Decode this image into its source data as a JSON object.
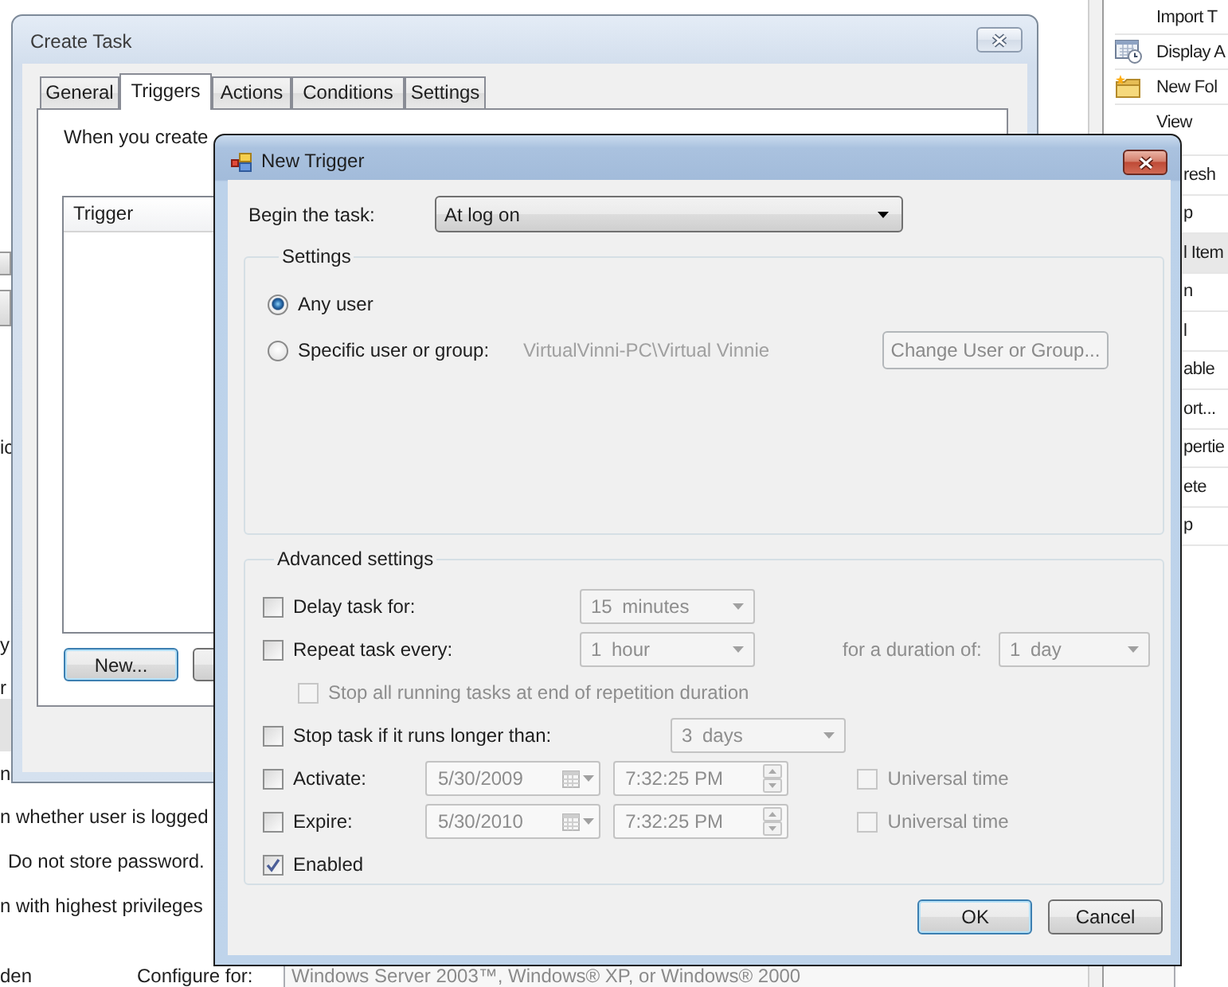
{
  "background_window": {
    "left_edge": [
      {
        "kind": "button"
      },
      {
        "kind": "button"
      },
      {
        "kind": "text",
        "text": "ic",
        "selected": false
      },
      {
        "kind": "text",
        "text": "y",
        "selected": false
      },
      {
        "kind": "text",
        "text": "r",
        "selected": false
      },
      {
        "kind": "row",
        "selected": true
      },
      {
        "kind": "text",
        "text": "n",
        "selected": false
      }
    ],
    "options": [
      "n whether user is logged",
      "Do not store password.",
      "n with highest privileges"
    ],
    "bottom_left_text": "den",
    "configure": {
      "label": "Configure for:",
      "value": "Windows Server 2003™, Windows® XP, or Windows® 2000",
      "disabled": true
    },
    "actions": [
      {
        "kind": "action",
        "label": "Import T"
      },
      {
        "kind": "action",
        "label": "Display A"
      },
      {
        "kind": "action",
        "label": "New Fol"
      },
      {
        "kind": "action",
        "label": "View"
      }
    ],
    "actions_partly_hidden": [
      {
        "kind": "action",
        "label": "resh"
      },
      {
        "kind": "action",
        "label": "p"
      },
      {
        "kind": "header",
        "label": "l Item"
      },
      {
        "kind": "action",
        "label": "n"
      },
      {
        "kind": "action",
        "label": "l"
      },
      {
        "kind": "action",
        "label": "able"
      },
      {
        "kind": "action",
        "label": "ort..."
      },
      {
        "kind": "action",
        "label": "pertie"
      },
      {
        "kind": "action",
        "label": "ete"
      },
      {
        "kind": "action",
        "label": "p"
      }
    ]
  },
  "create_task": {
    "title": "Create Task",
    "tabs": [
      {
        "label": "General",
        "selected": false
      },
      {
        "label": "Triggers",
        "selected": true
      },
      {
        "label": "Actions",
        "selected": false
      },
      {
        "label": "Conditions",
        "selected": false
      },
      {
        "label": "Settings",
        "selected": false
      }
    ],
    "description": "When you create",
    "trigger_list": {
      "columns": [
        "Trigger"
      ]
    },
    "buttons": [
      {
        "kind": "labeled",
        "label": "New...",
        "default": true
      },
      {
        "kind": "covered",
        "default": false
      }
    ]
  },
  "new_trigger": {
    "title": "New Trigger",
    "begin": {
      "label": "Begin the task:",
      "value": "At log on"
    },
    "settings": {
      "title": "Settings",
      "options": [
        {
          "label": "Any user",
          "selected": true
        },
        {
          "label": "Specific user or group:",
          "selected": false,
          "user": "VirtualVinni-PC\\Virtual Vinnie",
          "user_disabled": true,
          "button": {
            "label": "Change User or Group...",
            "disabled": true
          }
        }
      ]
    },
    "advanced": {
      "title": "Advanced settings",
      "rows": [
        {
          "kind": "interval",
          "label": "Delay task for:",
          "checked": false,
          "value": "15 minutes",
          "value_disabled": true
        },
        {
          "kind": "interval",
          "label": "Repeat task every:",
          "checked": false,
          "value": "1 hour",
          "value_disabled": true,
          "extra_label": "for a duration of:",
          "extra_value": "1 day"
        },
        {
          "kind": "sub",
          "label": "Stop all running tasks at end of repetition duration",
          "checked": false,
          "disabled": true
        },
        {
          "kind": "limit",
          "label": "Stop task if it runs longer than:",
          "checked": false,
          "value": "3 days",
          "value_disabled": true
        },
        {
          "kind": "date",
          "label": "Activate:",
          "checked": false,
          "date": "5/30/2009",
          "time": "7:32:25 PM",
          "value_disabled": true,
          "utc": {
            "label": "Universal time",
            "checked": false,
            "disabled": true
          }
        },
        {
          "kind": "date",
          "label": "Expire:",
          "checked": false,
          "date": "5/30/2010",
          "time": "7:32:25 PM",
          "value_disabled": true,
          "utc": {
            "label": "Universal time",
            "checked": false,
            "disabled": true
          }
        },
        {
          "kind": "plain",
          "label": "Enabled",
          "checked": true
        }
      ]
    },
    "buttons": [
      {
        "label": "OK",
        "default": true
      },
      {
        "label": "Cancel",
        "default": false
      }
    ]
  }
}
